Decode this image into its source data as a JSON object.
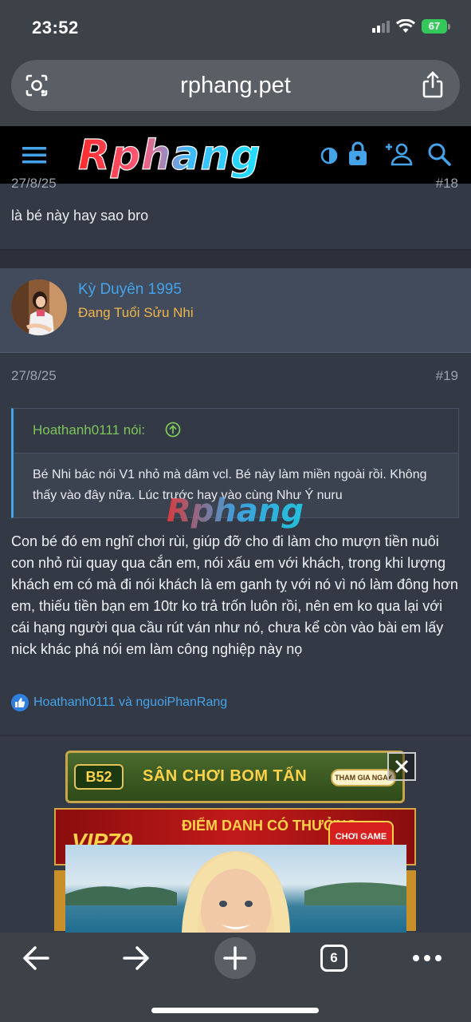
{
  "status_bar": {
    "time": "23:52",
    "battery": "67"
  },
  "browser": {
    "url": "rphang.pet",
    "tab_count": "6"
  },
  "site": {
    "logo_text": "Rphang"
  },
  "previous_post": {
    "date": "27/8/25",
    "number": "#18",
    "body": "là bé này hay sao bro"
  },
  "post": {
    "username": "Kỳ Duyên 1995",
    "user_title": "Đang Tuổi Sửu Nhi",
    "date": "27/8/25",
    "number": "#19",
    "quote": {
      "author": "Hoathanh0111 nói:",
      "text": "Bé Nhi bác nói V1 nhỏ mà dâm vcl. Bé này làm miền ngoài rồi. Không thấy vào đây nữa. Lúc trước hay vào cùng Như Ý nuru"
    },
    "body": "Con bé đó em nghĩ chơi rùi, giúp đỡ cho đi làm cho mượn tiền nuôi con nhỏ rùi quay qua cắn em, nói xấu em với khách, trong khi lượng khách em có mà đi nói khách là em ganh tỵ với nó vì nó làm đông hơn em, thiếu tiền bạn em 10tr ko trả trốn luôn rồi, nên em ko qua lại với cái hạng người qua cầu rút ván như nó, chưa kể còn vào bài em lấy nick khác phá nói em làm công nghiệp này nọ",
    "reactions": "Hoathanh0111 và nguoiPhanRang"
  },
  "ads": {
    "ad1_logo": "B52",
    "ad1_text": "SÂN CHƠI BOM TẤN",
    "ad1_button": "THAM GIA NGAY",
    "ad2_logo": "VIP79",
    "ad2_text": "ĐIỂM DANH CÓ THƯỞNG",
    "ad2_button": "CHƠI GAME NGAY"
  },
  "colors": {
    "accent_blue": "#45a3ea",
    "quote_green": "#7cc65d",
    "title_orange": "#f0b44a",
    "battery_green": "#34c759"
  }
}
